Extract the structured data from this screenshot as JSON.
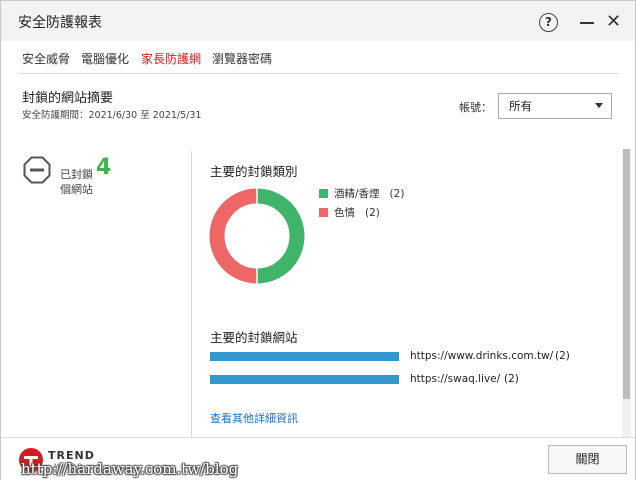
{
  "window": {
    "title": "安全防護報表"
  },
  "tabs": [
    "安全威脅",
    "電腦優化",
    "家長防護網",
    "瀏覽器密碼"
  ],
  "active_tab_color": "#d71920",
  "summary": {
    "title": "封鎖的網站摘要",
    "period": "安全防護期間：2021/6/30 至 2021/5/31"
  },
  "account": {
    "label": "帳號：",
    "value": "所有"
  },
  "blocked": {
    "prefix": "已封鎖",
    "count": "4",
    "unit": "個網站",
    "count_color": "#3fb44a"
  },
  "categories": {
    "title": "主要的封鎖類別",
    "items": [
      {
        "label": "酒精/香煙",
        "count": "(2)",
        "value": 2,
        "color": "#3fb46a"
      },
      {
        "label": "色情",
        "count": "(2)",
        "value": 2,
        "color": "#ee6666"
      }
    ]
  },
  "sites": {
    "title": "主要的封鎖網站",
    "items": [
      {
        "url": "https://www.drinks.com.tw/",
        "count": "(2)",
        "value": 2
      },
      {
        "url": "https://swaq.live/",
        "count": "(2)",
        "value": 2
      }
    ],
    "bar_color": "#3498d0",
    "more_link": "查看其他詳細資訊"
  },
  "footer": {
    "logo_text": "TREND",
    "logo_sub": "MICRO",
    "watermark": "http://hardaway.com.tw/blog",
    "close_label": "關閉"
  }
}
